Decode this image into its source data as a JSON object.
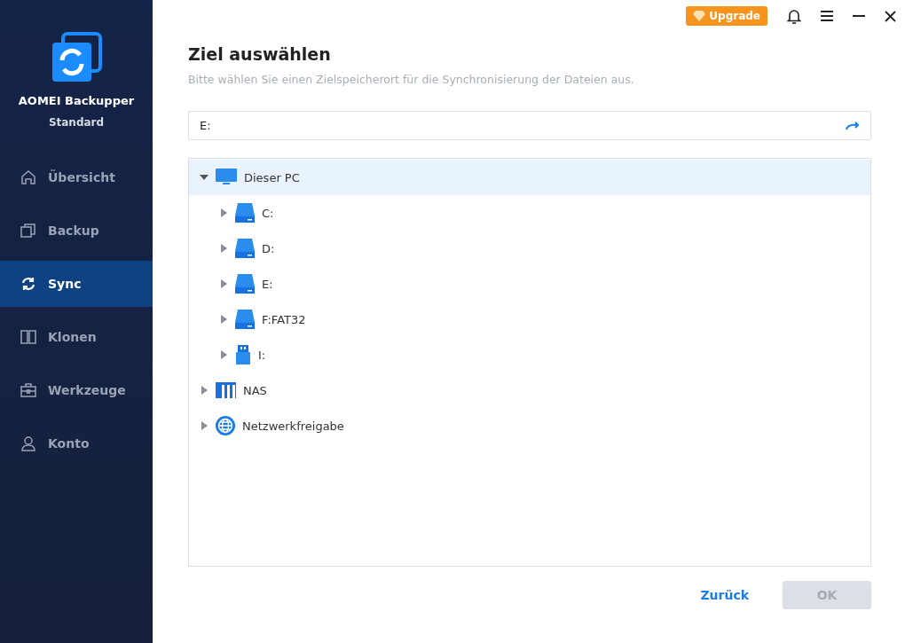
{
  "app": {
    "name": "AOMEI Backupper",
    "edition": "Standard"
  },
  "nav": [
    {
      "label": "Übersicht",
      "kind": "home",
      "selected": false
    },
    {
      "label": "Backup",
      "kind": "backup",
      "selected": false
    },
    {
      "label": "Sync",
      "kind": "sync",
      "selected": true
    },
    {
      "label": "Klonen",
      "kind": "clone",
      "selected": false
    },
    {
      "label": "Werkzeuge",
      "kind": "tools",
      "selected": false
    },
    {
      "label": "Konto",
      "kind": "account",
      "selected": false
    }
  ],
  "titlebar": {
    "upgrade": "Upgrade"
  },
  "title": "Ziel auswählen",
  "subtitle": "Bitte wählen Sie einen Zielspeicherort für die Synchronisierung der Dateien aus.",
  "path": {
    "value": "E:"
  },
  "tree": [
    {
      "label": "Dieser PC",
      "kind": "pc",
      "expanded": true,
      "selected": true,
      "children": [
        {
          "label": "C:",
          "kind": "disk",
          "expanded": false,
          "selected": false
        },
        {
          "label": "D:",
          "kind": "disk",
          "expanded": false,
          "selected": false
        },
        {
          "label": "E:",
          "kind": "disk",
          "expanded": false,
          "selected": false
        },
        {
          "label": "F:FAT32",
          "kind": "disk",
          "expanded": false,
          "selected": false
        },
        {
          "label": "I:",
          "kind": "usb",
          "expanded": false,
          "selected": false
        }
      ]
    },
    {
      "label": "NAS",
      "kind": "nas",
      "expanded": false,
      "selected": false
    },
    {
      "label": "Netzwerkfreigabe",
      "kind": "network",
      "expanded": false,
      "selected": false
    }
  ],
  "buttons": {
    "back": "Zurück",
    "ok": {
      "label": "OK",
      "disabled": true
    }
  }
}
